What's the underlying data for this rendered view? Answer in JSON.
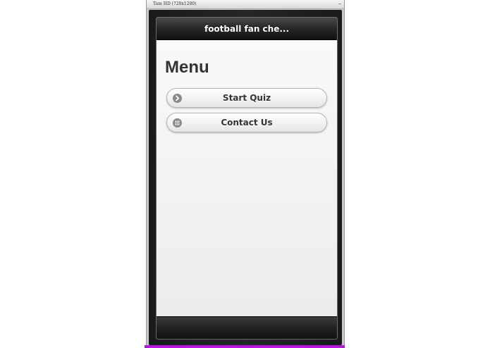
{
  "emulator": {
    "title": "Tam HD (720x1280)",
    "minimize_glyph": "–"
  },
  "app": {
    "header_title": "football fan che...",
    "page_heading": "Menu",
    "menu_items": [
      {
        "label": "Start Quiz",
        "icon": "arrow-right-circle-icon"
      },
      {
        "label": "Contact Us",
        "icon": "grid-circle-icon"
      }
    ]
  },
  "colors": {
    "header_bg": "#111111",
    "content_bg": "#f3f3f3",
    "accent_bar": "#b21bd6",
    "icon_gray": "#8a8a8a"
  }
}
